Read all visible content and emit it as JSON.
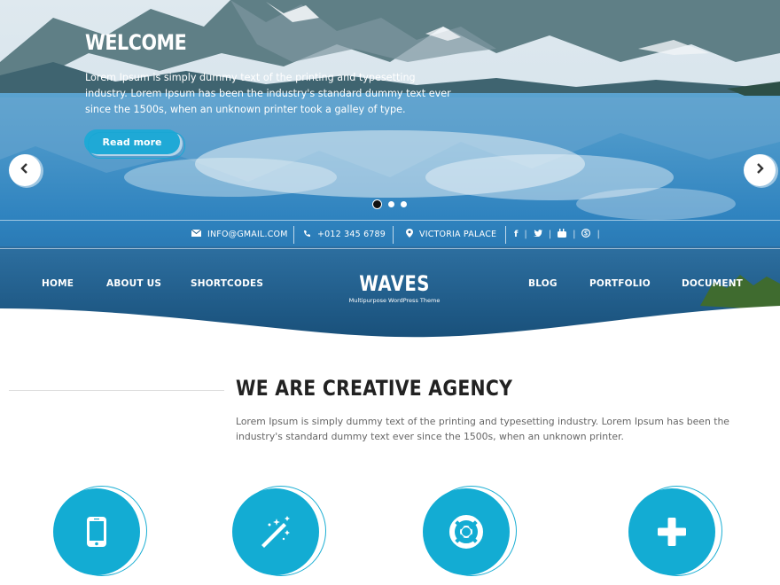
{
  "hero": {
    "title": "WELCOME",
    "text": "Lorem Ipsum is simply dummy text of the printing and typesetting industry. Lorem Ipsum has been the industry's standard dummy text ever since the 1500s, when an unknown printer took a galley of type.",
    "button": "Read more",
    "prev_icon": "chevron-left-icon",
    "next_icon": "chevron-right-icon",
    "slides": 3,
    "active_slide": 1
  },
  "topbar": {
    "email": "INFO@GMAIL.COM",
    "phone": "+012 345 6789",
    "location": "VICTORIA PALACE",
    "social": [
      "facebook-icon",
      "twitter-icon",
      "youtube-icon",
      "skype-icon"
    ]
  },
  "nav": {
    "left": [
      "HOME",
      "ABOUT US",
      "SHORTCODES"
    ],
    "right": [
      "BLOG",
      "PORTFOLIO",
      "DOCUMENT"
    ],
    "logo_title": "WAVES",
    "logo_subtitle": "Multipurpose WordPress Theme"
  },
  "section": {
    "title": "WE ARE CREATIVE AGENCY",
    "text": "Lorem Ipsum is simply dummy text of the printing and typesetting industry. Lorem Ipsum has been the industry's standard dummy text ever since the 1500s, when an unknown printer."
  },
  "features": [
    "mobile-icon",
    "magic-wand-icon",
    "lifebuoy-icon",
    "plus-icon"
  ],
  "colors": {
    "accent": "#13acd3",
    "heading": "#222222",
    "body_text": "#666666"
  }
}
